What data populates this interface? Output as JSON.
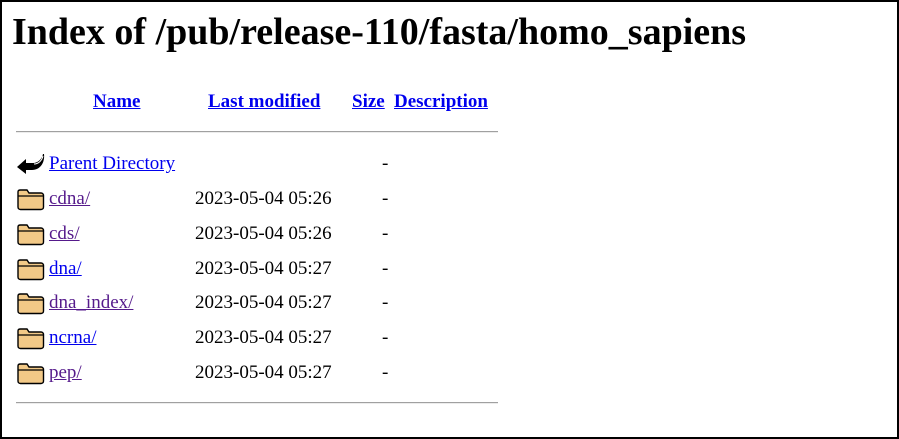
{
  "page": {
    "title": "Index of /pub/release-110/fasta/homo_sapiens"
  },
  "table": {
    "headers": {
      "name": "Name",
      "last_modified": "Last modified",
      "size": "Size",
      "description": "Description"
    },
    "parent": {
      "icon": "back-arrow-icon",
      "label": "Parent Directory",
      "size": "-"
    },
    "rows": [
      {
        "icon": "folder-icon",
        "name": "cdna/",
        "modified": "2023-05-04 05:26",
        "size": "-"
      },
      {
        "icon": "folder-icon",
        "name": "cds/",
        "modified": "2023-05-04 05:26",
        "size": "-"
      },
      {
        "icon": "folder-icon",
        "name": "dna/",
        "modified": "2023-05-04 05:27",
        "size": "-"
      },
      {
        "icon": "folder-icon",
        "name": "dna_index/",
        "modified": "2023-05-04 05:27",
        "size": "-"
      },
      {
        "icon": "folder-icon",
        "name": "ncrna/",
        "modified": "2023-05-04 05:27",
        "size": "-"
      },
      {
        "icon": "folder-icon",
        "name": "pep/",
        "modified": "2023-05-04 05:27",
        "size": "-"
      }
    ]
  },
  "colors": {
    "link": "#0000ee",
    "visited_link": "#551a8b",
    "folder_fill": "#f2c987",
    "folder_outline": "#000000"
  }
}
